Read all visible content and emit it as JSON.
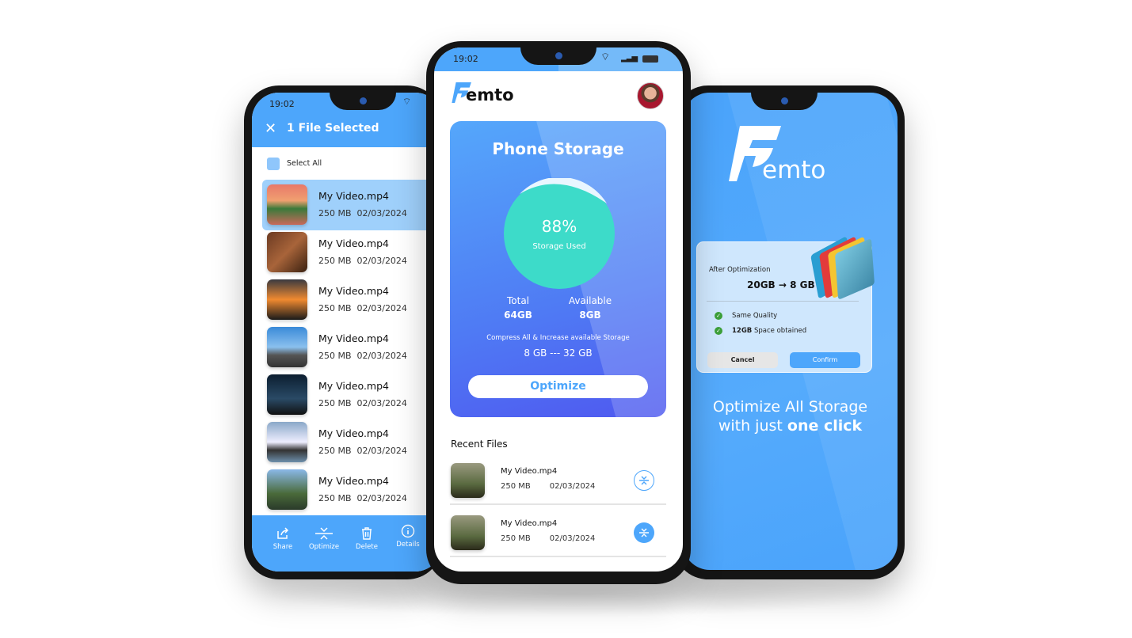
{
  "status_time": "19:02",
  "left": {
    "title": "1 File Selected",
    "select_all": "Select All",
    "files": [
      {
        "name": "My Video.mp4",
        "size": "250 MB",
        "date": "02/03/2024",
        "selected": true
      },
      {
        "name": "My Video.mp4",
        "size": "250 MB",
        "date": "02/03/2024"
      },
      {
        "name": "My Video.mp4",
        "size": "250 MB",
        "date": "02/03/2024"
      },
      {
        "name": "My Video.mp4",
        "size": "250 MB",
        "date": "02/03/2024"
      },
      {
        "name": "My Video.mp4",
        "size": "250 MB",
        "date": "02/03/2024"
      },
      {
        "name": "My Video.mp4",
        "size": "250 MB",
        "date": "02/03/2024"
      },
      {
        "name": "My Video.mp4",
        "size": "250 MB",
        "date": "02/03/2024"
      }
    ],
    "toolbar": {
      "share": "Share",
      "optimize": "Optimize",
      "delete": "Delete",
      "details": "Details"
    }
  },
  "center": {
    "logo": "emto",
    "card_title": "Phone Storage",
    "used_percent": "88%",
    "used_label": "Storage Used",
    "used_fraction": 0.88,
    "total_label": "Total",
    "total_value": "64GB",
    "available_label": "Available",
    "available_value": "8GB",
    "compress_text": "Compress All & Increase available Storage",
    "compress_range": "8 GB --- 32 GB",
    "optimize_button": "Optimize",
    "recent_title": "Recent Files",
    "recent": [
      {
        "name": "My Video.mp4",
        "size": "250 MB",
        "date": "02/03/2024"
      },
      {
        "name": "My Video.mp4",
        "size": "250 MB",
        "date": "02/03/2024"
      }
    ]
  },
  "right": {
    "logo": "emto",
    "dialog_label": "After Optimization",
    "dialog_value": "20GB → 8 GB",
    "check1": "Same Quality",
    "check2_bold": "12GB",
    "check2_rest": " Space obtained",
    "cancel": "Cancel",
    "confirm": "Confirm",
    "tagline1": "Optimize All Storage",
    "tagline2_pre": "with just ",
    "tagline2_bold": "one click"
  },
  "colors": {
    "primary": "#4da6fb",
    "teal": "#3ddbc9",
    "card_dark": "#4f59f0"
  }
}
